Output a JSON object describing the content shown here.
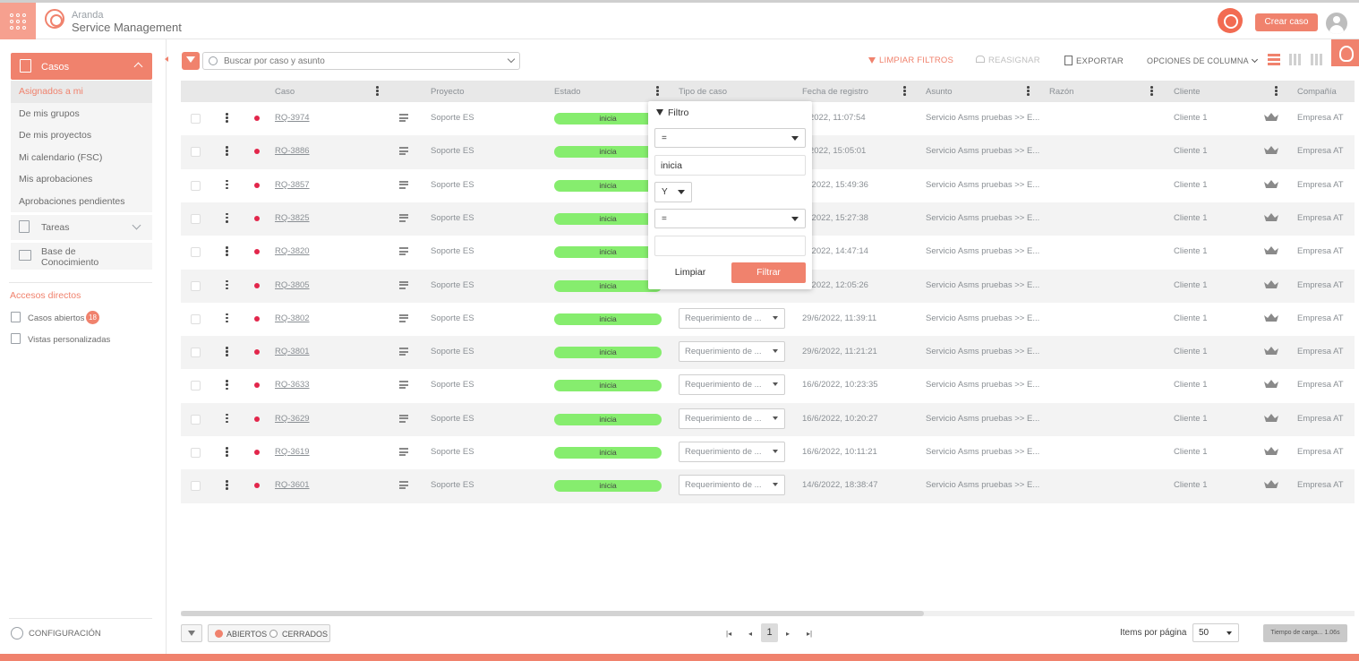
{
  "header": {
    "brand_top": "Aranda",
    "brand_bottom": "Service Management",
    "create_label": "Crear caso"
  },
  "sidebar": {
    "casos_label": "Casos",
    "sub_items": [
      "Asignados a mi",
      "De mis grupos",
      "De mis proyectos",
      "Mi calendario (FSC)",
      "Mis aprobaciones",
      "Aprobaciones pendientes"
    ],
    "tareas_label": "Tareas",
    "base_line1": "Base de",
    "base_line2": "Conocimiento",
    "accesos_title": "Accesos directos",
    "casos_abiertos_label": "Casos abiertos",
    "casos_abiertos_count": "18",
    "vistas_label": "Vistas personalizadas",
    "config_label": "CONFIGURACIÓN"
  },
  "toolbar": {
    "search_placeholder": "Buscar por caso y asunto",
    "limpiar": "LIMPIAR FILTROS",
    "reasignar": "REASIGNAR",
    "exportar": "EXPORTAR",
    "opciones": "OPCIONES DE COLUMNA"
  },
  "columns": {
    "caso": "Caso",
    "proyecto": "Proyecto",
    "estado": "Estado",
    "tipo": "Tipo de caso",
    "fecha": "Fecha de registro",
    "asunto": "Asunto",
    "razon": "Razón",
    "cliente": "Cliente",
    "compania": "Compañía"
  },
  "rows": [
    {
      "id": "RQ-3974",
      "project": "Soporte ES",
      "status": "inicia",
      "type": "",
      "date": "7/2022, 11:07:54",
      "subject": "Servicio Asms pruebas >> E...",
      "client": "Cliente 1",
      "company": "Empresa AT"
    },
    {
      "id": "RQ-3886",
      "project": "Soporte ES",
      "status": "inicia",
      "type": "",
      "date": "7/2022, 15:05:01",
      "subject": "Servicio Asms pruebas >> E...",
      "client": "Cliente 1",
      "company": "Empresa AT"
    },
    {
      "id": "RQ-3857",
      "project": "Soporte ES",
      "status": "inicia",
      "type": "",
      "date": "/6/2022, 15:49:36",
      "subject": "Servicio Asms pruebas >> E...",
      "client": "Cliente 1",
      "company": "Empresa AT"
    },
    {
      "id": "RQ-3825",
      "project": "Soporte ES",
      "status": "inicia",
      "type": "",
      "date": "/6/2022, 15:27:38",
      "subject": "Servicio Asms pruebas >> E...",
      "client": "Cliente 1",
      "company": "Empresa AT"
    },
    {
      "id": "RQ-3820",
      "project": "Soporte ES",
      "status": "inicia",
      "type": "",
      "date": "/6/2022, 14:47:14",
      "subject": "Servicio Asms pruebas >> E...",
      "client": "Cliente 1",
      "company": "Empresa AT"
    },
    {
      "id": "RQ-3805",
      "project": "Soporte ES",
      "status": "inicia",
      "type": "",
      "date": "/6/2022, 12:05:26",
      "subject": "Servicio Asms pruebas >> E...",
      "client": "Cliente 1",
      "company": "Empresa AT"
    },
    {
      "id": "RQ-3802",
      "project": "Soporte ES",
      "status": "inicia",
      "type": "Requerimiento de ...",
      "date": "29/6/2022, 11:39:11",
      "subject": "Servicio Asms pruebas >> E...",
      "client": "Cliente 1",
      "company": "Empresa AT"
    },
    {
      "id": "RQ-3801",
      "project": "Soporte ES",
      "status": "inicia",
      "type": "Requerimiento de ...",
      "date": "29/6/2022, 11:21:21",
      "subject": "Servicio Asms pruebas >> E...",
      "client": "Cliente 1",
      "company": "Empresa AT"
    },
    {
      "id": "RQ-3633",
      "project": "Soporte ES",
      "status": "inicia",
      "type": "Requerimiento de ...",
      "date": "16/6/2022, 10:23:35",
      "subject": "Servicio Asms pruebas >> E...",
      "client": "Cliente 1",
      "company": "Empresa AT"
    },
    {
      "id": "RQ-3629",
      "project": "Soporte ES",
      "status": "inicia",
      "type": "Requerimiento de ...",
      "date": "16/6/2022, 10:20:27",
      "subject": "Servicio Asms pruebas >> E...",
      "client": "Cliente 1",
      "company": "Empresa AT"
    },
    {
      "id": "RQ-3619",
      "project": "Soporte ES",
      "status": "inicia",
      "type": "Requerimiento de ...",
      "date": "16/6/2022, 10:11:21",
      "subject": "Servicio Asms pruebas >> E...",
      "client": "Cliente 1",
      "company": "Empresa AT"
    },
    {
      "id": "RQ-3601",
      "project": "Soporte ES",
      "status": "inicia",
      "type": "Requerimiento de ...",
      "date": "14/6/2022, 18:38:47",
      "subject": "Servicio Asms pruebas >> E...",
      "client": "Cliente 1",
      "company": "Empresa AT"
    }
  ],
  "filter_popup": {
    "title": "Filtro",
    "op1": "=",
    "value1": "inicia",
    "logic": "Y",
    "op2": "=",
    "value2": "",
    "clear_label": "Limpiar",
    "apply_label": "Filtrar"
  },
  "footer": {
    "abiertos": "ABIERTOS",
    "cerrados": "CERRADOS",
    "page": "1",
    "items_label": "Items por página",
    "items_value": "50",
    "load_time": "Tiempo de carga... 1.06s"
  },
  "colors": {
    "accent": "#f0826d",
    "status_green": "#86ed6e",
    "priority_red": "#e2264b"
  }
}
